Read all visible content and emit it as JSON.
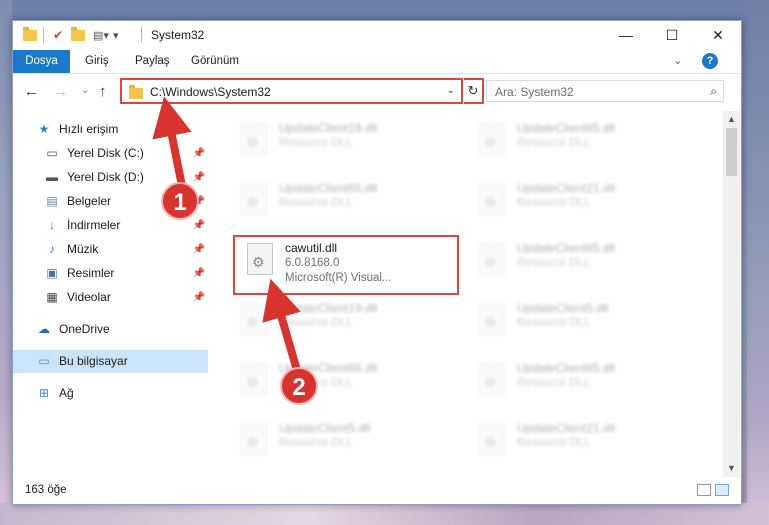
{
  "window": {
    "title": "System32",
    "minimize_glyph": "—",
    "maximize_glyph": "☐",
    "close_glyph": "✕"
  },
  "ribbon": {
    "tabs": [
      "Dosya",
      "Giriş",
      "Paylaş",
      "Görünüm"
    ],
    "collapse_glyph": "⌄",
    "help_glyph": "?"
  },
  "nav": {
    "back_glyph": "←",
    "forward_glyph": "→",
    "recent_glyph": "⌄",
    "up_glyph": "↑",
    "address": "C:\\Windows\\System32",
    "address_dropdown_glyph": "⌄",
    "refresh_glyph": "↻",
    "search_placeholder": "Ara: System32",
    "search_icon_glyph": "⌕"
  },
  "sidebar": {
    "items": [
      {
        "label": "Hızlı erişim",
        "icon": "star-icon",
        "glyph": "★",
        "color": "#2b7fd6",
        "pinned": false
      },
      {
        "label": "Yerel Disk (C:)",
        "icon": "drive-icon",
        "glyph": "▭",
        "color": "#4a4a4a",
        "pinned": true
      },
      {
        "label": "Yerel Disk (D:)",
        "icon": "drive-icon",
        "glyph": "▬",
        "color": "#4a4a4a",
        "pinned": true
      },
      {
        "label": "Belgeler",
        "icon": "documents-icon",
        "glyph": "▤",
        "color": "#5a7fb5",
        "pinned": true
      },
      {
        "label": "İndirmeler",
        "icon": "download-icon",
        "glyph": "↓",
        "color": "#2b7fd6",
        "pinned": true
      },
      {
        "label": "Müzik",
        "icon": "music-icon",
        "glyph": "♪",
        "color": "#2b7fd6",
        "pinned": true
      },
      {
        "label": "Resimler",
        "icon": "pictures-icon",
        "glyph": "▣",
        "color": "#4a6f9c",
        "pinned": true
      },
      {
        "label": "Videolar",
        "icon": "video-icon",
        "glyph": "▦",
        "color": "#4a4a4a",
        "pinned": true
      },
      {
        "label": "OneDrive",
        "icon": "cloud-icon",
        "glyph": "☁",
        "color": "#1a6fc4",
        "pinned": false
      },
      {
        "label": "Bu bilgisayar",
        "icon": "computer-icon",
        "glyph": "▭",
        "color": "#3a8fd8",
        "pinned": false
      },
      {
        "label": "Ağ",
        "icon": "network-icon",
        "glyph": "⊞",
        "color": "#3a8fd8",
        "pinned": false
      }
    ],
    "pin_glyph": "📌"
  },
  "files": [
    {
      "name": "UpdateClient19.dll",
      "type": "Resource DLL"
    },
    {
      "name": "UpdateClient65.dll",
      "type": "Resource DLL"
    },
    {
      "name": "UpdateClient65.dll",
      "type": "Resource DLL"
    },
    {
      "name": "UpdateClient21.dll",
      "type": "Resource DLL"
    },
    {
      "name": "cawutil.dll",
      "type": "6.0.8168.0",
      "desc": "Microsoft(R) Visual..."
    },
    {
      "name": "UpdateClient65.dll",
      "type": "Resource DLL"
    },
    {
      "name": "UpdateClient19.dll",
      "type": "Resource DLL"
    },
    {
      "name": "UpdateClient5.dll",
      "type": "Resource DLL"
    },
    {
      "name": "UpdateClient65.dll",
      "type": "Resource DLL"
    },
    {
      "name": "UpdateClient65.dll",
      "type": "Resource DLL"
    },
    {
      "name": "UpdateClient5.dll",
      "type": "Resource DLL"
    },
    {
      "name": "UpdateClient21.dll",
      "type": "Resource DLL"
    }
  ],
  "status": {
    "count": "163 öğe"
  },
  "annotations": {
    "step1": "1",
    "step2": "2",
    "color": "#e64141"
  }
}
